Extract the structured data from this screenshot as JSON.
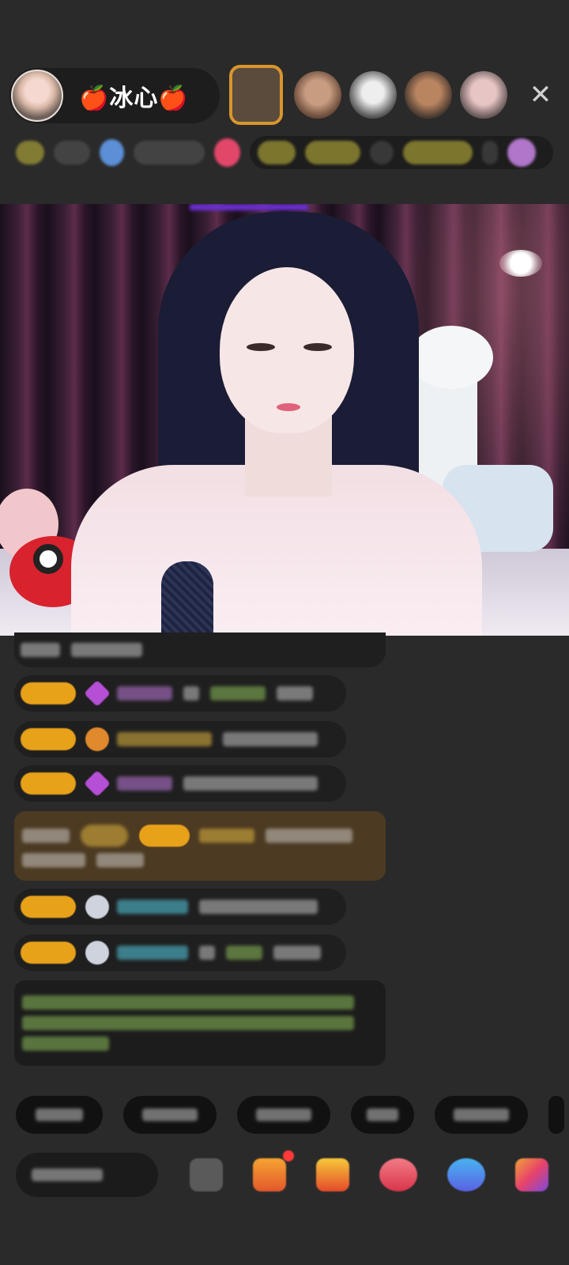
{
  "header": {
    "host_name": "🍎冰心🍎",
    "close_symbol": "✕",
    "viewers": [
      "viewer-1",
      "viewer-2",
      "viewer-3",
      "viewer-4",
      "viewer-5"
    ]
  },
  "colors": {
    "background": "#2a2a2a",
    "badge": "#e8a21a",
    "highlight_message": "#4c3a22",
    "system_message_text": "#9fc05a",
    "notification_dot": "#ff3a3a"
  },
  "icons": {
    "close": "close-icon",
    "input_tool": "keyboard-icon",
    "gift": "gift-icon",
    "treasure": "treasure-icon",
    "lipstick": "lipstick-icon",
    "game": "game-icon",
    "more": "more-icon"
  }
}
